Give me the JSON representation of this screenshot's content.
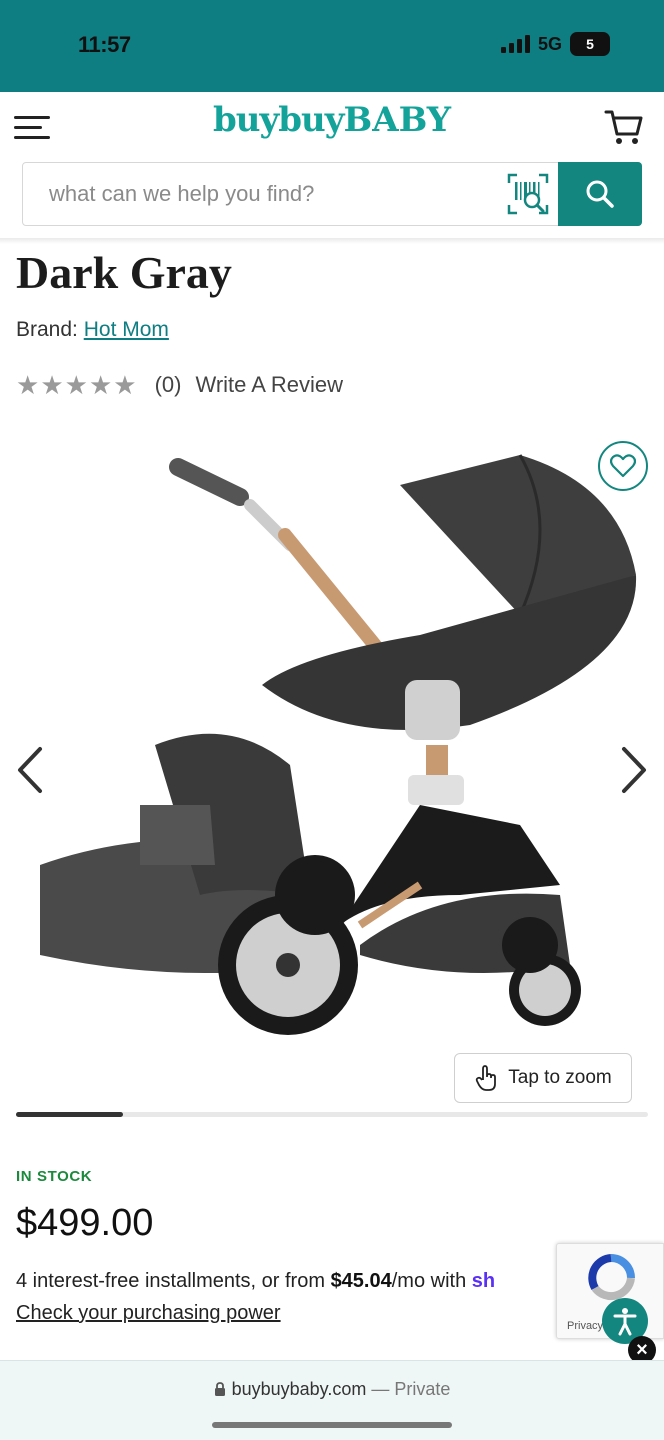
{
  "status_bar": {
    "time": "11:57",
    "network": "5G",
    "battery": "5"
  },
  "header": {
    "logo_part1": "buybuy",
    "logo_part2": "BABY",
    "search_placeholder": "what can we help you find?"
  },
  "product": {
    "title_visible": "Dark Gray",
    "brand_label": "Brand:",
    "brand_name": "Hot Mom",
    "rating_stars": 0,
    "review_count": "(0)",
    "write_review": "Write A Review",
    "zoom_label": "Tap to zoom",
    "gallery_progress": 0.17,
    "stock_status": "IN STOCK",
    "price": "$499.00",
    "installments_prefix": "4 interest-free installments, or from ",
    "installments_amount": "$45.04",
    "installments_suffix": "/mo with ",
    "installments_provider": "sh",
    "purchasing_power": "Check your purchasing power"
  },
  "overlays": {
    "recaptcha_text": "Privacy - Terms"
  },
  "browser": {
    "domain": "buybuybaby.com",
    "separator": " — ",
    "mode": "Private"
  },
  "colors": {
    "brand_teal": "#13877f",
    "status_teal": "#0f7e82",
    "in_stock_green": "#1b8a3d",
    "shop_purple": "#5a31f4"
  }
}
